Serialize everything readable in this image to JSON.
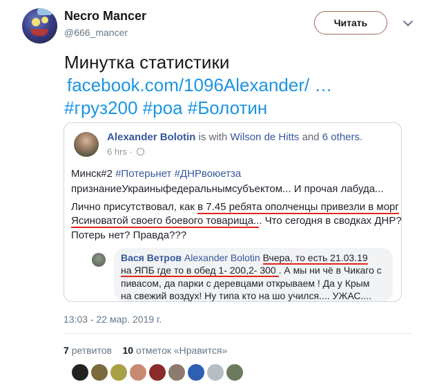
{
  "author": {
    "name": "Necro Mancer",
    "handle": "@666_mancer"
  },
  "follow_button": "Читать",
  "tweet": {
    "line1": "Минутка статистики",
    "link": "facebook.com/1096Alexander/ …",
    "hashtags": [
      "#груз200",
      "#роа",
      "#Болотин"
    ]
  },
  "quote": {
    "author": "Alexander Bolotin",
    "is_with": "is with",
    "with_name": "Wilson de Hitts",
    "and_text": "and",
    "others": "6 others.",
    "time": "6 hrs ·",
    "line1_prefix": "Минск#2",
    "line1_tags": "#Потерьнет #ДНРвоюетза",
    "line2": "признаниеУкраиныфедеральнымсубъектом... И прочая лабуда...",
    "line3_a": "Лично присутствовал, как ",
    "line3_b": "в 7.45 ребята ополченцы привезли в морг",
    "line4_a": "Ясиноватой своего боевого товарища..",
    "line4_b": ". Что сегодня в сводках ДНР?",
    "line5": "Потерь нет? Правда???",
    "comment": {
      "author": "Вася Ветров",
      "reply_to": "Alexander Bolotin",
      "l1": "Вчера, то есть 21.03.19",
      "l2_a": "на ЯПБ где то в обед 1- 200,2- 300 ",
      "l2_b": ". А мы ни чё в Чикаго с",
      "l3": "пивасом, да парки с деревцами открываем ! Да у Крым",
      "l4": "на свежий воздух! Ну типа кто на шо учился.... УЖАС...."
    }
  },
  "timestamp": "13:03 - 22 мар. 2019 г.",
  "stats": {
    "retweets_count": "7",
    "retweets_label": "ретвитов",
    "likes_count": "10",
    "likes_label": "отметок «Нравится»"
  },
  "likers_colors": [
    "#222222",
    "#7b6a3a",
    "#a8a046",
    "#c98a73",
    "#8a2a2a",
    "#8c7b6e",
    "#2f5fb3",
    "#b7bdc4",
    "#6b7a5e"
  ]
}
